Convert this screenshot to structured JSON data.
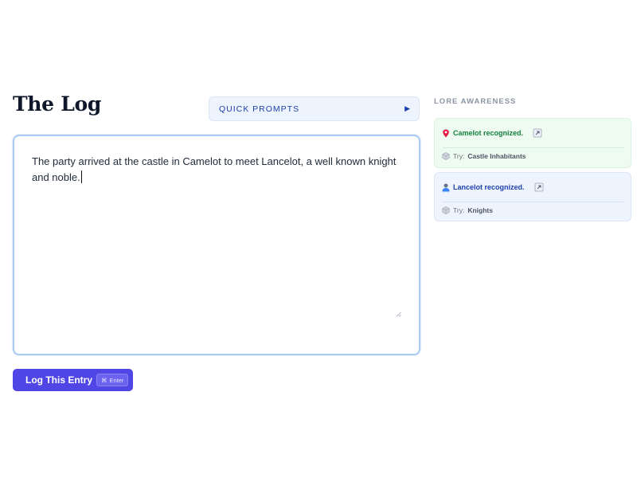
{
  "header": {
    "title": "The Log"
  },
  "quick_prompts": {
    "label": "QUICK PROMPTS",
    "icon": "play-triangle-icon"
  },
  "editor": {
    "text": "The party arrived at the castle in Camelot to meet Lancelot, a well known knight and noble."
  },
  "log_button": {
    "label": "Log This Entry",
    "shortcut_symbol": "⌘",
    "shortcut_key": "Enter"
  },
  "lore": {
    "heading": "LORE AWARENESS",
    "cards": [
      {
        "icon": "map-pin-icon",
        "text": "Camelot recognized.",
        "try_prefix": "Try:",
        "try_value": "Castle Inhabitants",
        "accent": "#15803d",
        "bg": "#eefbf1"
      },
      {
        "icon": "person-icon",
        "text": "Lancelot recognized.",
        "try_prefix": "Try:",
        "try_value": "Knights",
        "accent": "#1e40af",
        "bg": "#eef4fd"
      }
    ]
  },
  "colors": {
    "primary": "#4f46e5",
    "editor_border": "#a9cbf4"
  }
}
